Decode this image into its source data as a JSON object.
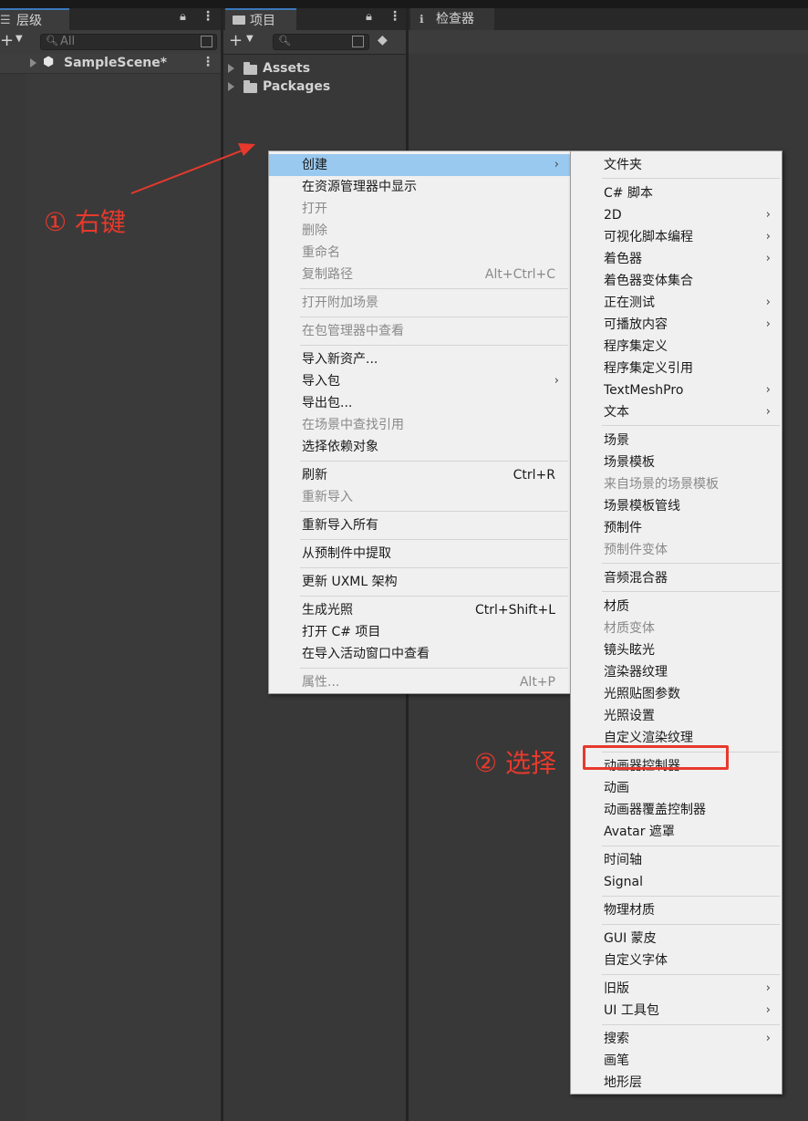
{
  "hierarchy": {
    "tab_label": "层级",
    "search_placeholder": "All",
    "scene_name": "SampleScene*"
  },
  "project": {
    "tab_label": "项目",
    "folders": [
      "Assets",
      "Packages"
    ]
  },
  "inspector": {
    "tab_label": "检查器"
  },
  "annotations": {
    "step1": "① 右键",
    "step2": "② 选择",
    "color": "#e8392c"
  },
  "context_menu": {
    "items": [
      {
        "label": "创建",
        "shortcut": "",
        "submenu": true,
        "disabled": false,
        "highlighted": true
      },
      {
        "label": "在资源管理器中显示",
        "shortcut": "",
        "disabled": false
      },
      {
        "label": "打开",
        "shortcut": "",
        "disabled": true
      },
      {
        "label": "删除",
        "shortcut": "",
        "disabled": true
      },
      {
        "label": "重命名",
        "shortcut": "",
        "disabled": true
      },
      {
        "label": "复制路径",
        "shortcut": "Alt+Ctrl+C",
        "disabled": true
      },
      {
        "label": "打开附加场景",
        "shortcut": "",
        "disabled": true
      },
      {
        "label": "在包管理器中查看",
        "shortcut": "",
        "disabled": true
      },
      {
        "label": "导入新资产...",
        "shortcut": "",
        "disabled": false
      },
      {
        "label": "导入包",
        "shortcut": "",
        "submenu": true,
        "disabled": false
      },
      {
        "label": "导出包...",
        "shortcut": "",
        "disabled": false
      },
      {
        "label": "在场景中查找引用",
        "shortcut": "",
        "disabled": true
      },
      {
        "label": "选择依赖对象",
        "shortcut": "",
        "disabled": false
      },
      {
        "label": "刷新",
        "shortcut": "Ctrl+R",
        "disabled": false
      },
      {
        "label": "重新导入",
        "shortcut": "",
        "disabled": true
      },
      {
        "label": "重新导入所有",
        "shortcut": "",
        "disabled": false
      },
      {
        "label": "从预制件中提取",
        "shortcut": "",
        "disabled": false
      },
      {
        "label": "更新 UXML 架构",
        "shortcut": "",
        "disabled": false
      },
      {
        "label": "生成光照",
        "shortcut": "Ctrl+Shift+L",
        "disabled": false
      },
      {
        "label": "打开 C# 项目",
        "shortcut": "",
        "disabled": false
      },
      {
        "label": "在导入活动窗口中查看",
        "shortcut": "",
        "disabled": false
      },
      {
        "label": "属性...",
        "shortcut": "Alt+P",
        "disabled": true
      }
    ]
  },
  "create_submenu": {
    "items": [
      {
        "label": "文件夹"
      },
      {
        "label": "C# 脚本"
      },
      {
        "label": "2D",
        "submenu": true
      },
      {
        "label": "可视化脚本编程",
        "submenu": true
      },
      {
        "label": "着色器",
        "submenu": true
      },
      {
        "label": "着色器变体集合"
      },
      {
        "label": "正在测试",
        "submenu": true
      },
      {
        "label": "可播放内容",
        "submenu": true
      },
      {
        "label": "程序集定义"
      },
      {
        "label": "程序集定义引用"
      },
      {
        "label": "TextMeshPro",
        "submenu": true
      },
      {
        "label": "文本",
        "submenu": true
      },
      {
        "label": "场景"
      },
      {
        "label": "场景模板"
      },
      {
        "label": "来自场景的场景模板",
        "disabled": true
      },
      {
        "label": "场景模板管线"
      },
      {
        "label": "预制件"
      },
      {
        "label": "预制件变体",
        "disabled": true
      },
      {
        "label": "音频混合器"
      },
      {
        "label": "材质"
      },
      {
        "label": "材质变体",
        "disabled": true
      },
      {
        "label": "镜头眩光"
      },
      {
        "label": "渲染器纹理"
      },
      {
        "label": "光照贴图参数"
      },
      {
        "label": "光照设置"
      },
      {
        "label": "自定义渲染纹理"
      },
      {
        "label": "动画器控制器"
      },
      {
        "label": "动画"
      },
      {
        "label": "动画器覆盖控制器"
      },
      {
        "label": "Avatar 遮罩"
      },
      {
        "label": "时间轴"
      },
      {
        "label": "Signal"
      },
      {
        "label": "物理材质"
      },
      {
        "label": "GUI 蒙皮"
      },
      {
        "label": "自定义字体"
      },
      {
        "label": "旧版",
        "submenu": true
      },
      {
        "label": "UI 工具包",
        "submenu": true
      },
      {
        "label": "搜索",
        "submenu": true
      },
      {
        "label": "画笔"
      },
      {
        "label": "地形层"
      }
    ]
  }
}
